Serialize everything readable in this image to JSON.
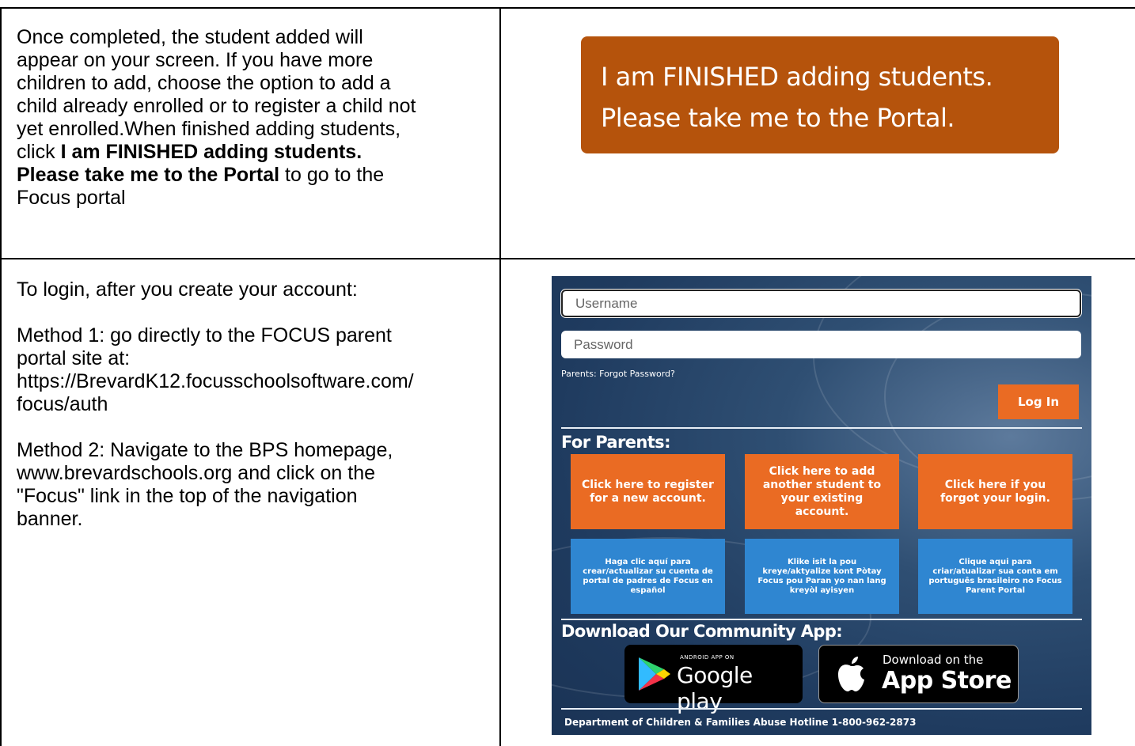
{
  "left_top": {
    "lines": [
      "Once completed, the student added will",
      "appear on your screen. If you have more",
      "children to add, choose the option to add a",
      "child already enrolled or to register a child not",
      "yet enrolled.When finished adding students,"
    ],
    "click_prefix": "click ",
    "bold_line1": "I am FINISHED adding students.",
    "bold_line2": "Please take me to the Portal",
    "suffix": " to go to the",
    "last_line": "Focus portal"
  },
  "finish_button": {
    "line1": "I am FINISHED adding students.",
    "line2": "Please take me to the Portal."
  },
  "left_bottom": {
    "intro": "To login, after you create your account:",
    "method1_line1": "Method 1: go directly to the FOCUS parent",
    "method1_line2": "portal site at:",
    "method1_url1": "https://BrevardK12.focusschoolsoftware.com/",
    "method1_url2": "focus/auth",
    "method2_line1": "Method 2: Navigate to the BPS homepage,",
    "method2_line2": "www.brevardschools.org and click on the",
    "method2_line3": "\"Focus\" link in the top of the navigation",
    "method2_line4": "banner."
  },
  "focus_login": {
    "username_placeholder": "Username",
    "password_placeholder": "Password",
    "forgot_link": "Parents: Forgot Password?",
    "login_button": "Log In",
    "parents_heading": "For Parents:",
    "tiles_orange": [
      "Click here to register for a new account.",
      "Click here to add another student to your existing account.",
      "Click here if you forgot your login."
    ],
    "tiles_blue": [
      "Haga clic aquí para crear/actualizar su cuenta de portal de padres de Focus en español",
      "Klike isit la pou kreye/aktyalize kont Pòtay Focus pou Paran yo nan lang kreyòl ayisyen",
      "Clique aqui para criar/atualizar sua conta em português brasileiro no Focus Parent Portal"
    ],
    "app_heading": "Download Our Community App:",
    "google_play_small": "ANDROID APP ON",
    "google_play_big": "Google play",
    "app_store_small": "Download on the",
    "app_store_big": "App Store",
    "hotline": "Department of Children & Families Abuse Hotline 1-800-962-2873",
    "colors": {
      "orange": "#ea6b23",
      "blue": "#2f86d1",
      "background": "#1f3b5f"
    }
  }
}
